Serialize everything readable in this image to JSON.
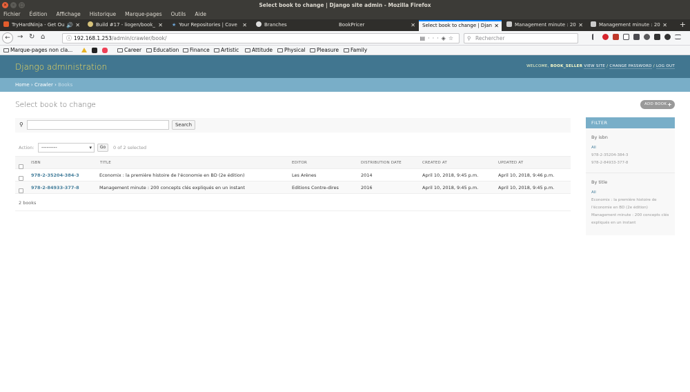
{
  "window": {
    "title": "Select book to change | Django site admin - Mozilla Firefox"
  },
  "menu": [
    "Fichier",
    "Édition",
    "Affichage",
    "Historique",
    "Marque-pages",
    "Outils",
    "Aide"
  ],
  "tabs": [
    {
      "label": "TryHardNinja - Get Ou",
      "fav_color": "#e25c2c"
    },
    {
      "label": "Build #17 - liogen/book_",
      "fav_color": "#d6c27a"
    },
    {
      "label": "Your Repositories | Cove",
      "fav_color": "#6fa8dc"
    },
    {
      "label": "Branches",
      "fav_color": "#dddddd"
    },
    {
      "label": "BookPricer",
      "fav_color": ""
    },
    {
      "label": "Select book to change | Djan",
      "fav_color": ""
    },
    {
      "label": "Management minute : 20",
      "fav_color": "#cccccc"
    },
    {
      "label": "Management minute : 20",
      "fav_color": "#cccccc"
    }
  ],
  "nav": {
    "url_host": "192.168.1.253",
    "url_path": "/admin/crawler/book/",
    "search_placeholder": "Rechercher"
  },
  "bookmarks": {
    "unsorted": "Marque-pages non cla...",
    "folders": [
      "Career",
      "Education",
      "Finance",
      "Artistic",
      "Attitude",
      "Physical",
      "Pleasure",
      "Family"
    ]
  },
  "header": {
    "brand": "Django administration",
    "welcome": "WELCOME,",
    "username": "BOOK_SELLER",
    "view_site": "VIEW SITE",
    "sep": "/",
    "change_password": "CHANGE PASSWORD",
    "logout": "LOG OUT"
  },
  "breadcrumbs": {
    "home": "Home",
    "app": "Crawler",
    "current": "Books",
    "sep": "›"
  },
  "content": {
    "title": "Select book to change",
    "add_button": "ADD BOOK",
    "search_button": "Search",
    "action_label": "Action:",
    "action_value": "---------",
    "go_button": "Go",
    "selected_count": "0 of 2 selected",
    "result_count": "2 books"
  },
  "table": {
    "columns": [
      "ISBN",
      "TITLE",
      "EDITOR",
      "DISTRIBUTION DATE",
      "CREATED AT",
      "UPDATED AT"
    ],
    "rows": [
      {
        "isbn": "978-2-35204-384-3",
        "title": "Economix : la première histoire de l'économie en BD (2e édition)",
        "editor": "Les Arènes",
        "distribution_date": "2014",
        "created_at": "April 10, 2018, 9:45 p.m.",
        "updated_at": "April 10, 2018, 9:46 p.m."
      },
      {
        "isbn": "978-2-84933-377-8",
        "title": "Management minute : 200 concepts clés expliqués en un instant",
        "editor": "Editions Contre-dires",
        "distribution_date": "2016",
        "created_at": "April 10, 2018, 9:45 p.m.",
        "updated_at": "April 10, 2018, 9:45 p.m."
      }
    ]
  },
  "filter": {
    "heading": "FILTER",
    "by_isbn": {
      "title": "By isbn",
      "options": [
        "All",
        "978-2-35204-384-3",
        "978-2-84933-377-8"
      ]
    },
    "by_title": {
      "title": "By title",
      "options": [
        "All",
        "Economix : la première histoire de l'économie en BD (2e édition)",
        "Management minute : 200 concepts clés expliqués en un instant"
      ]
    }
  },
  "colors": {
    "header": "#417690",
    "brand": "#f5dd5d",
    "breadcrumbs": "#79aec8",
    "link": "#447e9b"
  }
}
